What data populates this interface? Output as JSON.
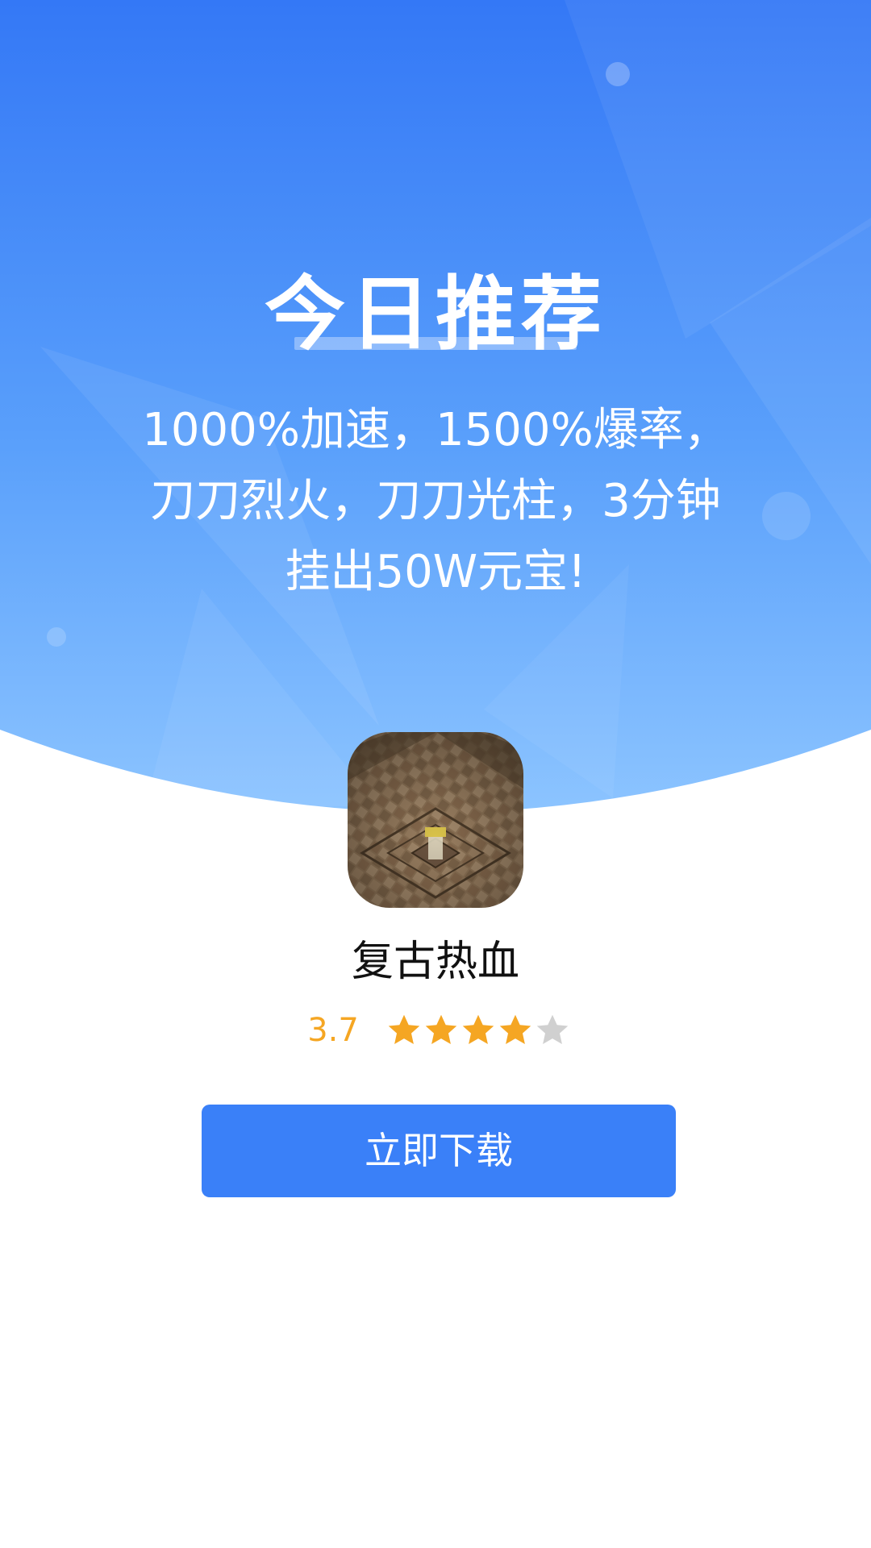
{
  "hero": {
    "title": "今日推荐",
    "description_lines": [
      "1000%加速，1500%爆率，",
      "刀刀烈火，刀刀光柱，3分钟",
      "挂出50W元宝!"
    ]
  },
  "app": {
    "name": "复古热血",
    "rating": "3.7",
    "stars_filled": 4,
    "stars_total": 5,
    "icon": "game-map-thumbnail"
  },
  "download_button": {
    "label": "立即下载"
  },
  "colors": {
    "hero_top": "#3478f6",
    "hero_bottom": "#8cc4ff",
    "accent": "#3a80f8",
    "star_filled": "#f5a623",
    "star_empty": "#d0d0d0"
  }
}
